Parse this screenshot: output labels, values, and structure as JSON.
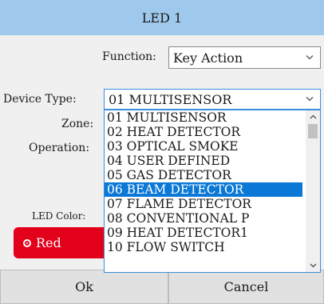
{
  "window": {
    "title": "LED 1"
  },
  "form": {
    "function_label": "Function:",
    "function_value": "Key Action",
    "device_type_label": "Device Type:",
    "device_type_value": "01 MULTISENSOR",
    "zone_label": "Zone:",
    "operation_label": "Operation:",
    "led_color_label": "LED Color:"
  },
  "dropdown": {
    "options": [
      "01 MULTISENSOR",
      "02 HEAT DETECTOR",
      "03 OPTICAL SMOKE",
      "04 USER DEFINED",
      "05 GAS DETECTOR",
      "06 BEAM DETECTOR",
      "07 FLAME DETECTOR",
      "08 CONVENTIONAL P",
      "09 HEAT DETECTOR1",
      "10 FLOW SWITCH"
    ],
    "highlighted": "06 BEAM DETECTOR"
  },
  "led_color": {
    "selected": "Red",
    "color": "#e3001b"
  },
  "buttons": {
    "ok": "Ok",
    "cancel": "Cancel"
  },
  "colors": {
    "titlebar": "#9fc9ec",
    "highlight": "#0a78d7",
    "focus": "#3b8ee0"
  }
}
